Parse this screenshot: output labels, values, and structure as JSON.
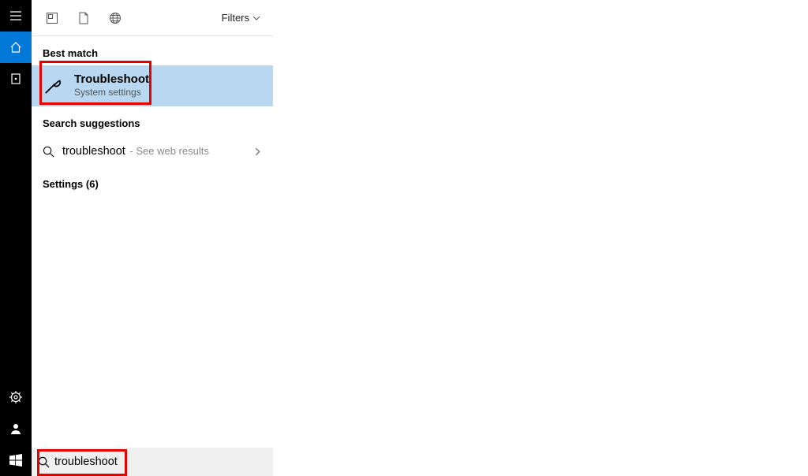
{
  "sidebar": {
    "items": [
      {
        "name": "menu-icon"
      },
      {
        "name": "home-icon"
      },
      {
        "name": "notebook-icon"
      }
    ],
    "bottom_items": [
      {
        "name": "gear-icon"
      },
      {
        "name": "user-icon"
      },
      {
        "name": "windows-start-icon"
      }
    ]
  },
  "topbar": {
    "icons": [
      {
        "name": "apps-icon"
      },
      {
        "name": "document-icon"
      },
      {
        "name": "globe-icon"
      }
    ],
    "filters_label": "Filters"
  },
  "sections": {
    "best_match_label": "Best match",
    "best_match": {
      "title": "Troubleshoot",
      "subtitle": "System settings"
    },
    "suggestions_label": "Search suggestions",
    "suggestion": {
      "term": "troubleshoot",
      "extra": " - See web results"
    },
    "settings_label": "Settings (6)"
  },
  "search": {
    "value": "troubleshoot"
  }
}
